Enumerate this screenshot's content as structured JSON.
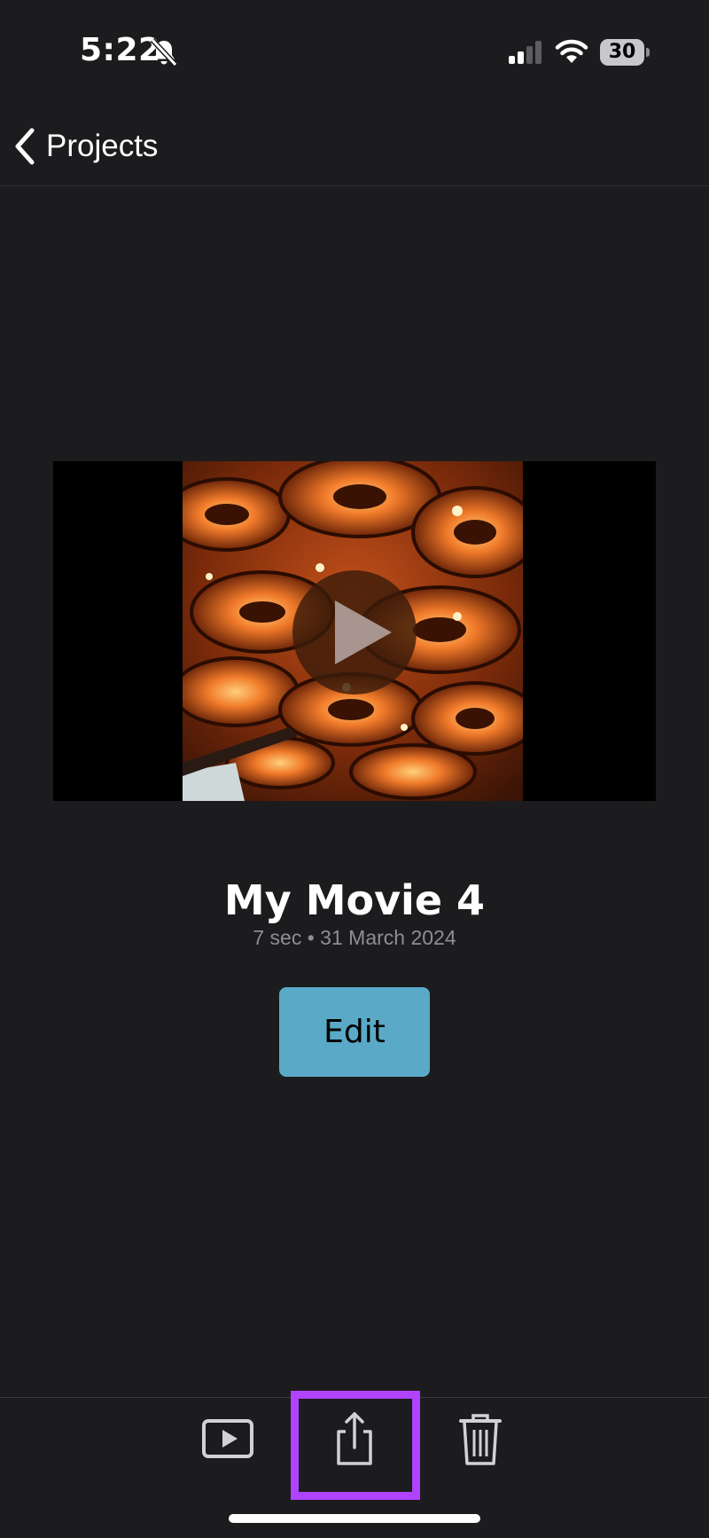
{
  "status_bar": {
    "time": "5:22",
    "battery_level": "30",
    "icons": [
      "bell-slash-icon",
      "cellular-signal-icon",
      "wifi-icon",
      "battery-icon"
    ]
  },
  "nav": {
    "back_label": "Projects",
    "back_icon": "chevron-left-icon"
  },
  "project": {
    "title": "My Movie 4",
    "meta": "7 sec • 31 March 2024",
    "edit_label": "Edit"
  },
  "toolbar": {
    "items": [
      {
        "icon": "play-icon",
        "label": "Play"
      },
      {
        "icon": "share-icon",
        "label": "Share"
      },
      {
        "icon": "trash-icon",
        "label": "Delete"
      }
    ],
    "highlight_color": "#b043ff"
  },
  "colors": {
    "background": "#1c1c1e",
    "accent": "#5aaac7"
  }
}
